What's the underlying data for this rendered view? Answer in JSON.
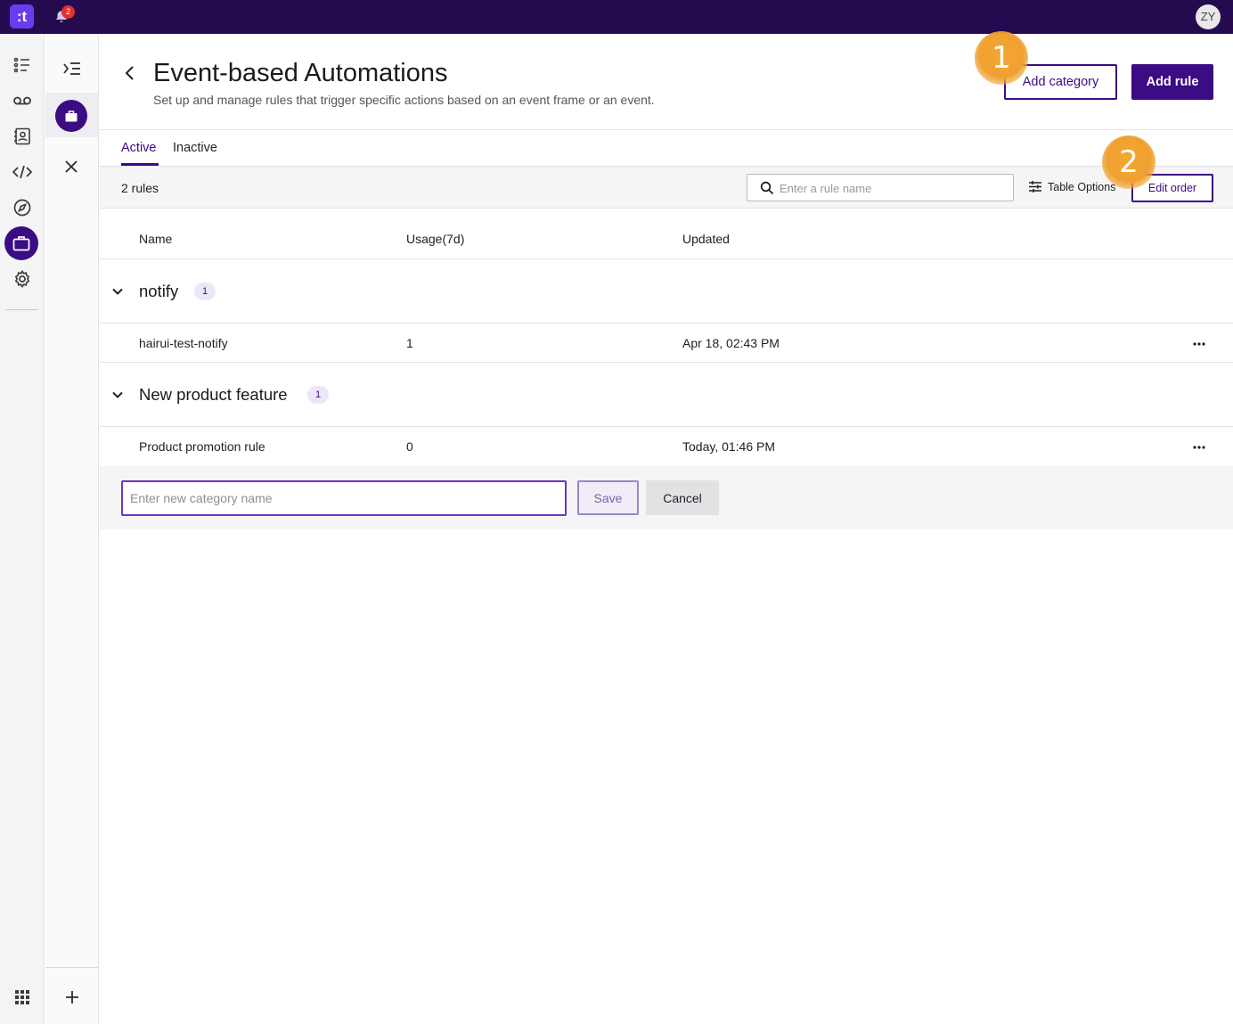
{
  "topbar": {
    "logo_text": ":t",
    "notifications_count": "2",
    "avatar_initials": "ZY"
  },
  "page": {
    "title": "Event-based Automations",
    "subtitle": "Set up and manage rules that trigger specific actions based on an event frame or an event.",
    "add_category_label": "Add category",
    "add_rule_label": "Add rule"
  },
  "callouts": [
    "1",
    "2"
  ],
  "tabs": [
    {
      "label": "Active",
      "active": true
    },
    {
      "label": "Inactive",
      "active": false
    }
  ],
  "toolbar": {
    "count": "2 rules",
    "search_placeholder": "Enter a rule name",
    "table_options_label": "Table Options",
    "edit_order_label": "Edit order"
  },
  "columns": [
    "Name",
    "Usage(7d)",
    "Updated"
  ],
  "groups": [
    {
      "name": "notify",
      "badge": "1",
      "rows": [
        {
          "name": "hairui-test-notify",
          "usage": "1",
          "updated": "Apr 18, 02:43 PM"
        }
      ]
    },
    {
      "name": "New product feature",
      "badge": "1",
      "rows": [
        {
          "name": "Product promotion rule",
          "usage": "0",
          "updated": "Today, 01:46 PM"
        }
      ]
    }
  ],
  "new_category": {
    "placeholder": "Enter new category name",
    "save_label": "Save",
    "cancel_label": "Cancel"
  },
  "colors": {
    "brand": "#240b4f",
    "accent": "#3b0c84",
    "callout": "#f0a030"
  }
}
